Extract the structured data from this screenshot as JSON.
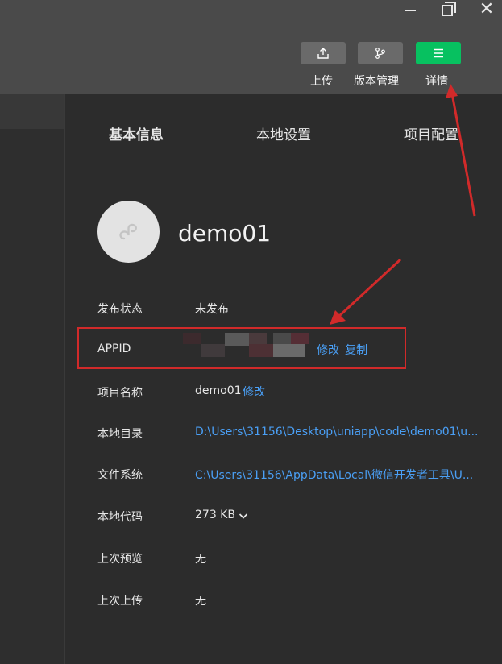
{
  "window": {
    "minimize_icon": "minimize-icon",
    "maximize_icon": "maximize-icon",
    "close_icon": "close-icon",
    "close_glyph": "✕"
  },
  "toolbar": {
    "upload": {
      "label": "上传",
      "icon": "upload-icon"
    },
    "version": {
      "label": "版本管理",
      "icon": "branch-icon"
    },
    "details": {
      "label": "详情",
      "icon": "menu-icon"
    },
    "accent_color": "#07c160"
  },
  "details": {
    "tabs": [
      {
        "label": "基本信息"
      },
      {
        "label": "本地设置"
      },
      {
        "label": "项目配置"
      }
    ],
    "project_name": "demo01",
    "avatar_icon": "mini-program-icon",
    "link_color": "#4a9ff5",
    "fields": {
      "publish_status": {
        "label": "发布状态",
        "value": "未发布"
      },
      "appid": {
        "label": "APPID",
        "edit": "修改",
        "copy": "复制"
      },
      "project_name": {
        "label": "项目名称",
        "value": "demo01",
        "edit": "修改"
      },
      "local_dir": {
        "label": "本地目录",
        "value": "D:\\Users\\31156\\Desktop\\uniapp\\code\\demo01\\u..."
      },
      "file_system": {
        "label": "文件系统",
        "value": "C:\\Users\\31156\\AppData\\Local\\微信开发者工具\\U..."
      },
      "local_code": {
        "label": "本地代码",
        "value": "273 KB"
      },
      "last_preview": {
        "label": "上次预览",
        "value": "无"
      },
      "last_upload": {
        "label": "上次上传",
        "value": "无"
      }
    }
  },
  "annotation": {
    "color": "#d12a2a"
  }
}
